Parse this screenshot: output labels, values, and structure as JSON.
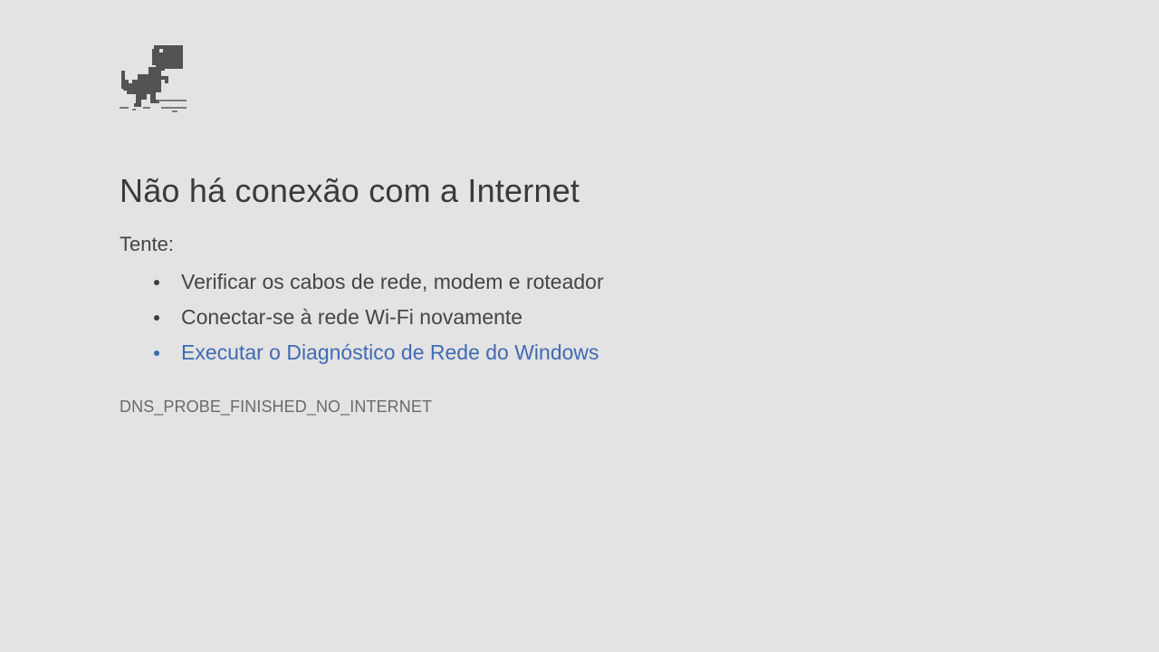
{
  "icons": {
    "offline": "dinosaur-icon"
  },
  "error": {
    "title": "Não há conexão com a Internet",
    "try_label": "Tente:",
    "suggestions": [
      "Verificar os cabos de rede, modem e roteador",
      "Conectar-se à rede Wi-Fi novamente"
    ],
    "diagnostics_link": "Executar o Diagnóstico de Rede do Windows",
    "code": "DNS_PROBE_FINISHED_NO_INTERNET"
  },
  "colors": {
    "background": "#e3e3e3",
    "text": "#3c3c3c",
    "link": "#3f6bb3",
    "error_code": "#6a6a6a"
  }
}
